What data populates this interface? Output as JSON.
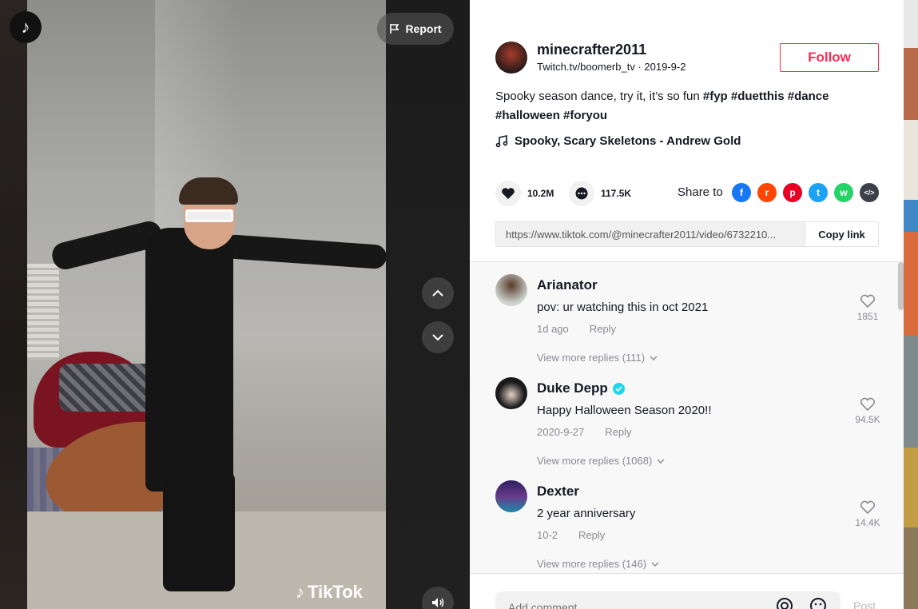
{
  "player": {
    "logo_icon": "tiktok-logo-icon",
    "report_label": "Report",
    "watermark": "TikTok"
  },
  "author": {
    "username": "minecrafter2011",
    "subline": "Twitch.tv/boomerb_tv · 2019-9-2",
    "follow_label": "Follow"
  },
  "caption": {
    "text": "Spooky season dance, try it, it’s so fun",
    "hashtags": [
      "#fyp",
      "#duetthis",
      "#dance",
      "#halloween",
      "#foryou"
    ],
    "tag1": "#fyp",
    "tag2": "#duetthis",
    "tag3": "#dance",
    "tag4": "#halloween",
    "tag5": "#foryou"
  },
  "music": {
    "title": "Spooky, Scary Skeletons - Andrew Gold"
  },
  "stats": {
    "likes": "10.2M",
    "comments": "117.5K"
  },
  "share": {
    "label": "Share to",
    "targets": [
      "facebook",
      "reddit",
      "pinterest",
      "twitter",
      "whatsapp",
      "embed"
    ]
  },
  "link": {
    "url": "https://www.tiktok.com/@minecrafter2011/video/6732210...",
    "copy_label": "Copy link"
  },
  "comments": [
    {
      "name": "Arianator",
      "text": "pov: ur watching this in oct 2021",
      "time": "1d ago",
      "reply_label": "Reply",
      "likes": "1851",
      "more": "View more replies (111)",
      "verified": false
    },
    {
      "name": "Duke Depp",
      "text": "Happy Halloween Season 2020!!",
      "time": "2020-9-27",
      "reply_label": "Reply",
      "likes": "94.5K",
      "more": "View more replies (1068)",
      "verified": true
    },
    {
      "name": "Dexter",
      "text": "2 year anniversary",
      "time": "10-2",
      "reply_label": "Reply",
      "likes": "14.4K",
      "more": "View more replies (146)",
      "verified": false
    }
  ],
  "composer": {
    "placeholder": "Add comment...",
    "post_label": "Post"
  },
  "colors": {
    "accent": "#fe2c55",
    "verified": "#20d5ec",
    "text": "#161823",
    "muted": "#8a8b91"
  }
}
